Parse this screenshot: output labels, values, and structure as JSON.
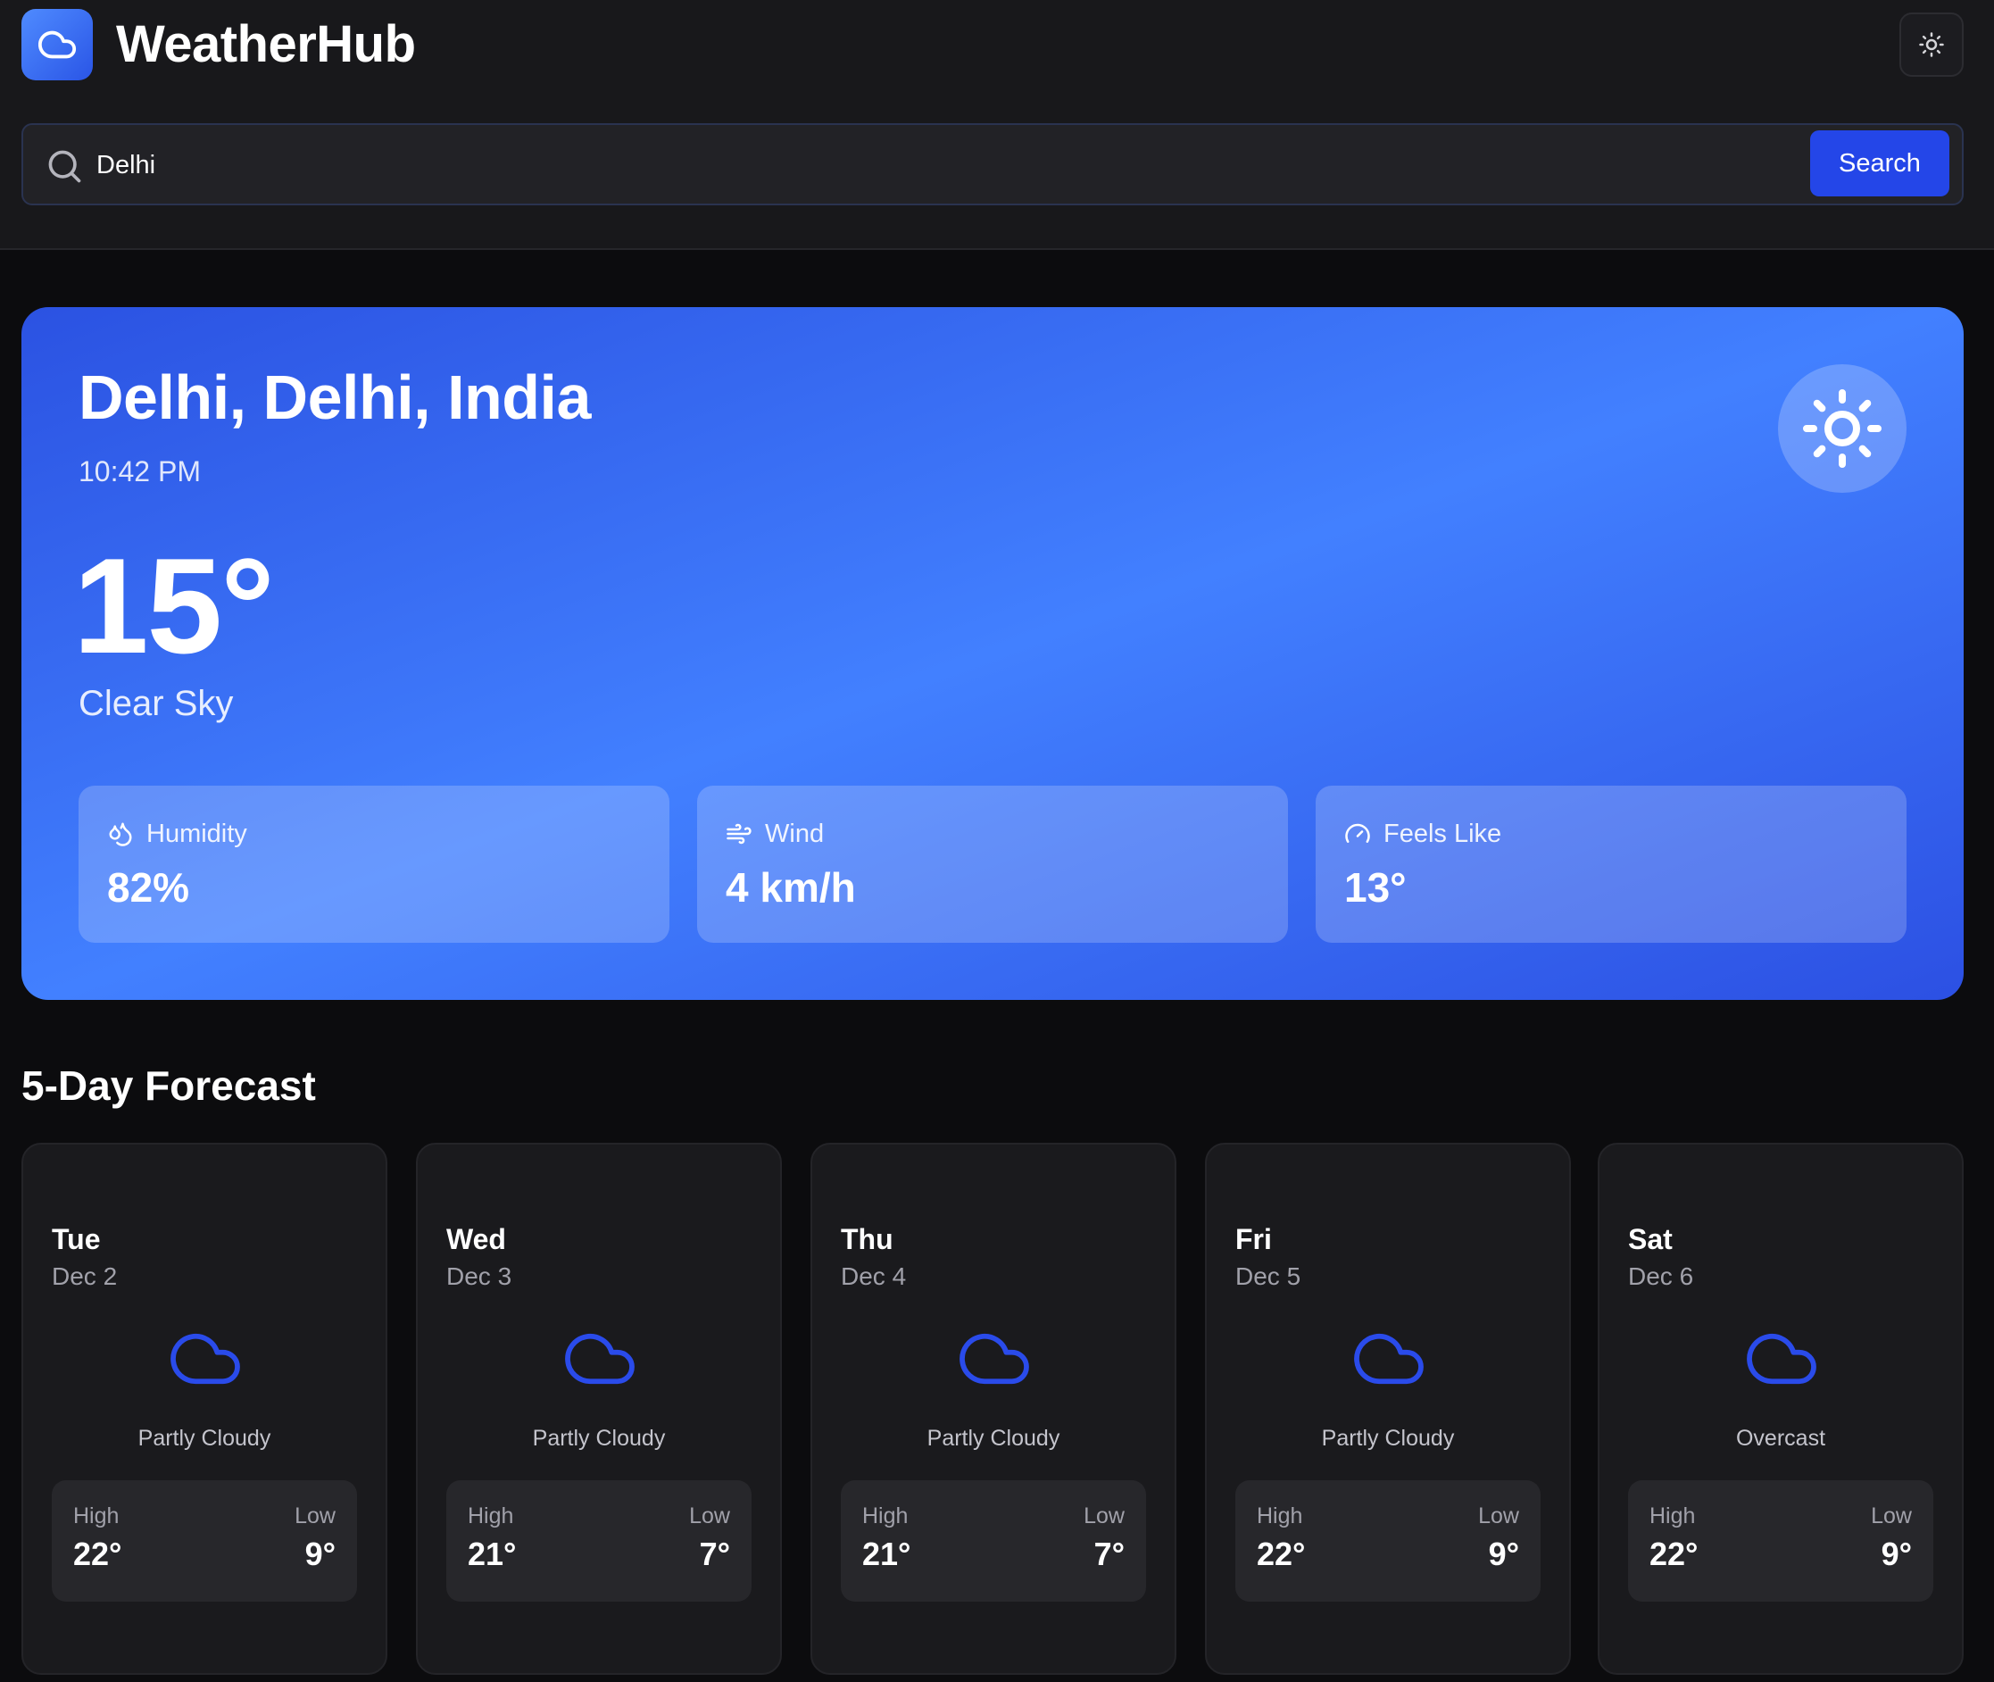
{
  "app": {
    "title": "WeatherHub",
    "logo_icon": "cloud-icon",
    "theme_icon": "sun-icon"
  },
  "search": {
    "value": "Delhi",
    "placeholder": "",
    "button_label": "Search"
  },
  "current": {
    "location": "Delhi, Delhi, India",
    "time": "10:42 PM",
    "temperature": "15°",
    "condition": "Clear Sky",
    "icon": "sun-icon",
    "stats": [
      {
        "label": "Humidity",
        "value": "82%",
        "icon": "droplets-icon"
      },
      {
        "label": "Wind",
        "value": "4 km/h",
        "icon": "wind-icon"
      },
      {
        "label": "Feels Like",
        "value": "13°",
        "icon": "gauge-icon"
      }
    ]
  },
  "forecast": {
    "title": "5-Day Forecast",
    "high_label": "High",
    "low_label": "Low",
    "days": [
      {
        "day": "Tue",
        "date": "Dec 2",
        "condition": "Partly Cloudy",
        "high": "22°",
        "low": "9°",
        "icon": "cloud-icon"
      },
      {
        "day": "Wed",
        "date": "Dec 3",
        "condition": "Partly Cloudy",
        "high": "21°",
        "low": "7°",
        "icon": "cloud-icon"
      },
      {
        "day": "Thu",
        "date": "Dec 4",
        "condition": "Partly Cloudy",
        "high": "21°",
        "low": "7°",
        "icon": "cloud-icon"
      },
      {
        "day": "Fri",
        "date": "Dec 5",
        "condition": "Partly Cloudy",
        "high": "22°",
        "low": "9°",
        "icon": "cloud-icon"
      },
      {
        "day": "Sat",
        "date": "Dec 6",
        "condition": "Overcast",
        "high": "22°",
        "low": "9°",
        "icon": "cloud-icon"
      }
    ]
  },
  "colors": {
    "accent": "#2446e8",
    "hero_gradient_start": "#2b52e2",
    "hero_gradient_mid": "#4280ff",
    "background": "#0c0c0e",
    "card": "#1a1a1d",
    "forecast_icon": "#2a4bea"
  }
}
